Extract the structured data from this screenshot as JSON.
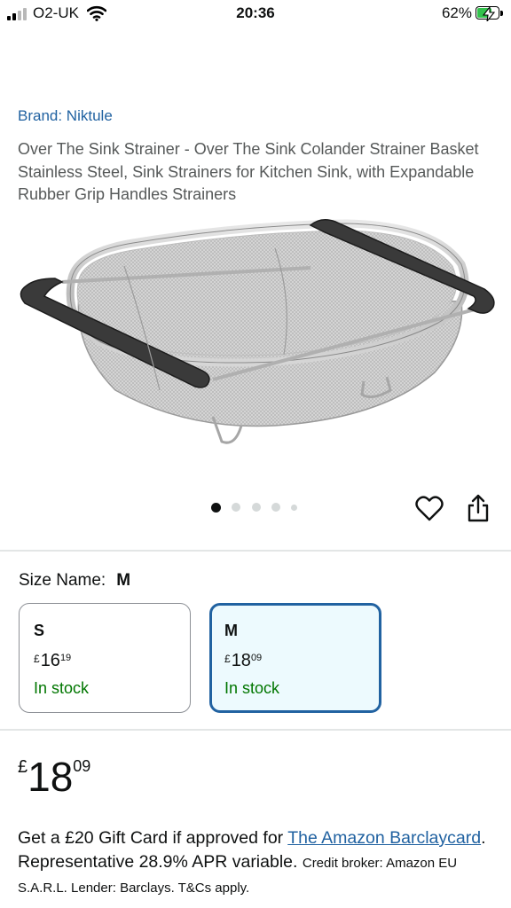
{
  "status_bar": {
    "carrier": "O2-UK",
    "time": "20:36",
    "battery_percent": "62%",
    "battery_level": 0.62,
    "icons": [
      "signal-icon",
      "wifi-icon",
      "battery-charging-icon"
    ]
  },
  "product": {
    "brand": "Brand: Niktule",
    "title": "Over The Sink Strainer - Over The Sink Colander Strainer Basket Stainless Steel, Sink Strainers for Kitchen Sink, with Expandable Rubber Grip Handles Strainers"
  },
  "gallery": {
    "image_count": 5,
    "active_index": 0,
    "icons": [
      "heart-icon",
      "share-icon"
    ]
  },
  "size": {
    "label": "Size Name:",
    "selected": "M",
    "options": [
      {
        "name": "S",
        "currency": "£",
        "whole": "16",
        "fraction": "19",
        "stock": "In stock"
      },
      {
        "name": "M",
        "currency": "£",
        "whole": "18",
        "fraction": "09",
        "stock": "In stock"
      }
    ]
  },
  "price": {
    "currency": "£",
    "whole": "18",
    "fraction": "09"
  },
  "promo": {
    "text_before_link": "Get a £20 Gift Card if approved for ",
    "link_text": "The Amazon Barclaycard",
    "text_after_link": ". Representative 28.9% APR variable. ",
    "small_text": "Credit broker: Amazon EU S.A.R.L. Lender: Barclays. T&Cs apply."
  },
  "colors": {
    "link": "#2162a1",
    "in_stock": "#007600",
    "selected_border": "#2162a1",
    "selected_bg": "#edfafe"
  }
}
